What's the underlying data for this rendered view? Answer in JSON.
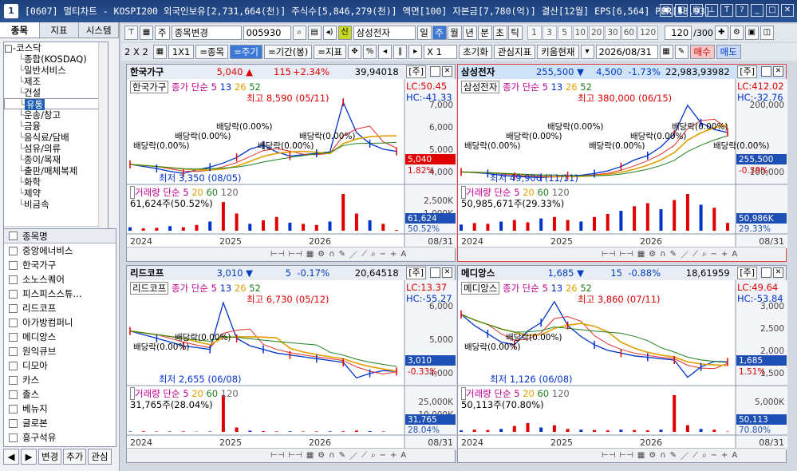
{
  "window": {
    "app_number": "1",
    "title": "[0607] 멀티차트 - KOSPI200 외국인보유[2,731,664(천)] 주식수[5,846,279(천)] 액면[100] 자본금[7,780(억)] 결산[12월] EPS[6,564] PER[38.93]",
    "controls": [
      "▣",
      "◧",
      "▤",
      "⊥",
      "T",
      "?",
      "_",
      "□",
      "✕"
    ]
  },
  "left_panel": {
    "tabs": [
      "종목",
      "지표",
      "시스템"
    ],
    "tree": {
      "root": "코스닥",
      "items": [
        "종합(KOSDAQ)",
        "일반서비스",
        "제조",
        "건설",
        "유통",
        "운송/창고",
        "금융",
        "음식료/담배",
        "섬유/의류",
        "종이/목재",
        "출판/매체복제",
        "화학",
        "제약",
        "비금속"
      ],
      "selected_index": 4
    },
    "list_header": "종목명",
    "stocks": [
      "중앙에너비스",
      "한국가구",
      "소노스퀘어",
      "피스피스스튜...",
      "리드코프",
      "아가방컴퍼니",
      "메디앙스",
      "원익큐브",
      "디모아",
      "카스",
      "졸스",
      "베뉴지",
      "글로본",
      "흥구석유"
    ],
    "buttons": [
      "◀",
      "▶",
      "변경",
      "추가",
      "관심"
    ]
  },
  "toolbar1": {
    "icons": [
      "pin-icon",
      "layout-icon"
    ],
    "type_select": "주",
    "change_select": "종목변경",
    "code_value": "005930",
    "new_badge": "신",
    "stock_name": "삼성전자",
    "periods": [
      "일",
      "주",
      "월",
      "년",
      "분",
      "초",
      "틱"
    ],
    "active_period": "주",
    "numbers": [
      "1",
      "3",
      "5",
      "10",
      "20",
      "30",
      "60",
      "120"
    ],
    "count_value": "120",
    "count_total": "/300"
  },
  "toolbar2": {
    "grid_label": "2 X 2",
    "one_by_one": "1X1",
    "mode_buttons": [
      "=종목",
      "=주기",
      "=기간(봉)",
      "=지표"
    ],
    "active_mode": "=주기",
    "ratio_select": "X 1",
    "reset": "초기화",
    "favorite": "관심지표",
    "kiwoom": "키움현재",
    "date_value": "2026/08/31",
    "buy": "매수",
    "sell": "매도"
  },
  "charts": [
    {
      "name": "한국가구",
      "price": "5,040",
      "arrow": "▲",
      "change": "115",
      "pct": "+2.34%",
      "volume": "39,940",
      "extra": "18",
      "dir": "up",
      "tag": "[주]",
      "legend_name": "한국가구",
      "ma_label": "종가 단순 5",
      "ma": [
        "13",
        "26",
        "52"
      ],
      "lc": "LC:50.45",
      "hc": "HC:-41.33",
      "high_label": "최고 8,590 (05/11)",
      "low_label": "최저 3,350 (08/05)",
      "dividends": [
        "배당락(0.00%)",
        "배당락(0.00%)",
        "배당락(0.00%)",
        "배당락(0.00%)",
        "배당락(0.00%)"
      ],
      "price_axis": [
        "7,000",
        "6,000",
        "5,000",
        "4,000"
      ],
      "last_price": "5,040",
      "last_pct": "1.82%",
      "vol_label": "거래량 단순 5",
      "vol_ma": [
        "20",
        "60",
        "120"
      ],
      "vol_value": "61,624주(50.52%)",
      "vol_axis": [
        "2,500K",
        "1,000K"
      ],
      "vol_last": "61,624",
      "vol_pct": "50.52%",
      "years": [
        "2024",
        "2025",
        "2026"
      ],
      "date_end": "08/31",
      "chart_data": {
        "type": "line",
        "y_range": [
          3000,
          9000
        ],
        "x": [
          0,
          6,
          12,
          18,
          24,
          30,
          36,
          42,
          48,
          54,
          60,
          66,
          72,
          78,
          84,
          90,
          96,
          102,
          108,
          114,
          120
        ],
        "close": [
          4100,
          3950,
          3800,
          3600,
          3450,
          3700,
          3900,
          4200,
          4600,
          5200,
          5500,
          5000,
          4700,
          4800,
          4900,
          5000,
          8590,
          6400,
          5600,
          5200,
          5040
        ],
        "volume": [
          300,
          200,
          250,
          400,
          300,
          500,
          800,
          2500,
          1500,
          600,
          900,
          1200,
          700,
          600,
          500,
          800,
          3200,
          1500,
          900,
          600,
          61
        ]
      }
    },
    {
      "name": "삼성전자",
      "price": "255,500",
      "arrow": "▼",
      "change": "4,500",
      "pct": "-1.73%",
      "volume": "22,983,939",
      "extra": "82",
      "dir": "dn",
      "tag": "[주]",
      "legend_name": "삼성전자",
      "ma_label": "종가 단순 5",
      "ma": [
        "13",
        "26",
        "52"
      ],
      "lc": "LC:412.02",
      "hc": "HC:-32.76",
      "high_label": "최고 380,000 (06/15)",
      "low_label": "최저 49,900 (11/11)",
      "dividends": [
        "배당락(0.00%)",
        "배당락(0.00%)",
        "배당락(0.00%)",
        "배당락(0.00%)",
        "배당락(0.00%)",
        "배당락(0.00%)",
        "배당락(0.00%)"
      ],
      "price_axis": [
        "200,000",
        "100,000"
      ],
      "last_price": "255,500",
      "last_pct": "-0.39%",
      "vol_label": "거래량 단순 5",
      "vol_ma": [
        "20",
        "60",
        "120"
      ],
      "vol_value": "50,985,671주(29.33%)",
      "vol_axis": [],
      "vol_last": "50,986K",
      "vol_pct": "29.33%",
      "years": [
        "2024",
        "2025",
        "2026"
      ],
      "date_end": "08/31",
      "chart_data": {
        "type": "line",
        "y_range": [
          40000,
          420000
        ],
        "x": [
          0,
          6,
          12,
          18,
          24,
          30,
          36,
          42,
          48,
          54,
          60,
          66,
          72,
          78,
          84,
          90,
          96,
          102,
          108,
          114,
          120
        ],
        "close": [
          75000,
          72000,
          68000,
          60000,
          55000,
          52000,
          50000,
          54000,
          58000,
          60000,
          68000,
          80000,
          100000,
          130000,
          150000,
          190000,
          250000,
          380000,
          300000,
          270000,
          255500
        ],
        "volume": [
          400,
          500,
          450,
          600,
          700,
          550,
          800,
          900,
          700,
          600,
          900,
          1100,
          1300,
          1600,
          1800,
          1400,
          2000,
          2400,
          1700,
          1500,
          510
        ]
      }
    },
    {
      "name": "리드코프",
      "price": "3,010",
      "arrow": "▼",
      "change": "5",
      "pct": "-0.17%",
      "volume": "20,645",
      "extra": "18",
      "dir": "dn",
      "tag": "[주]",
      "legend_name": "리드코프",
      "ma_label": "종가 단순 5",
      "ma": [
        "13",
        "26",
        "52"
      ],
      "lc": "LC:13.37",
      "hc": "HC:-55.27",
      "high_label": "최고 6,730 (05/12)",
      "low_label": "최저 2,655 (06/08)",
      "dividends": [
        "배당락(0.00%)",
        "배당락(0.00%)"
      ],
      "price_axis": [
        "6,000",
        "5,000",
        "4,000"
      ],
      "last_price": "3,010",
      "last_pct": "-0.33%",
      "vol_label": "거래량 단순 5",
      "vol_ma": [
        "20",
        "60",
        "120"
      ],
      "vol_value": "31,765주(28.04%)",
      "vol_axis": [
        "25,000K",
        "10,000K"
      ],
      "vol_last": "31,765",
      "vol_pct": "28.04%",
      "years": [
        "2024",
        "2025",
        "2026"
      ],
      "date_end": "08/31",
      "chart_data": {
        "type": "line",
        "y_range": [
          2500,
          7000
        ],
        "x": [
          0,
          6,
          12,
          18,
          24,
          30,
          36,
          42,
          48,
          54,
          60,
          66,
          72,
          78,
          84,
          90,
          96,
          102,
          108,
          114,
          120
        ],
        "close": [
          5200,
          5000,
          4800,
          4600,
          4400,
          4300,
          4200,
          6730,
          4800,
          4400,
          4200,
          4000,
          3900,
          3800,
          3700,
          3600,
          3500,
          2655,
          2900,
          3050,
          3010
        ],
        "volume": [
          300,
          400,
          250,
          300,
          350,
          200,
          300,
          25000,
          3000,
          800,
          500,
          300,
          400,
          250,
          300,
          350,
          400,
          900,
          500,
          300,
          31
        ]
      }
    },
    {
      "name": "메디앙스",
      "price": "1,685",
      "arrow": "▼",
      "change": "15",
      "pct": "-0.88%",
      "volume": "18,619",
      "extra": "59",
      "dir": "dn",
      "tag": "[주]",
      "legend_name": "메디앙스",
      "ma_label": "종가 단순 5",
      "ma": [
        "13",
        "26",
        "52"
      ],
      "lc": "LC:49.64",
      "hc": "HC:-53.84",
      "high_label": "최고 3,860 (07/11)",
      "low_label": "최저 1,126 (06/08)",
      "dividends": [
        "배당락(0.00%)",
        "배당락(0.00%)"
      ],
      "price_axis": [
        "3,000",
        "2,500",
        "2,000",
        "1,500"
      ],
      "last_price": "1,685",
      "last_pct": "1.51%",
      "vol_label": "거래량 단순 5",
      "vol_ma": [
        "20",
        "60",
        "120"
      ],
      "vol_value": "50,113주(70.80%)",
      "vol_axis": [
        "5,000K"
      ],
      "vol_last": "50,113",
      "vol_pct": "70.80%",
      "years": [
        "2024",
        "2025",
        "2026"
      ],
      "date_end": "08/31",
      "chart_data": {
        "type": "line",
        "y_range": [
          1000,
          4000
        ],
        "x": [
          0,
          6,
          12,
          18,
          24,
          30,
          36,
          42,
          48,
          54,
          60,
          66,
          72,
          78,
          84,
          90,
          96,
          102,
          108,
          114,
          120
        ],
        "close": [
          3400,
          3000,
          2700,
          2400,
          2300,
          2800,
          3100,
          3860,
          3000,
          2600,
          2300,
          2100,
          2000,
          1900,
          1850,
          1800,
          1750,
          1126,
          1500,
          1700,
          1685
        ],
        "volume": [
          200,
          300,
          250,
          400,
          800,
          1200,
          600,
          900,
          400,
          300,
          250,
          200,
          300,
          250,
          200,
          300,
          5000,
          900,
          400,
          300,
          50
        ]
      }
    }
  ]
}
